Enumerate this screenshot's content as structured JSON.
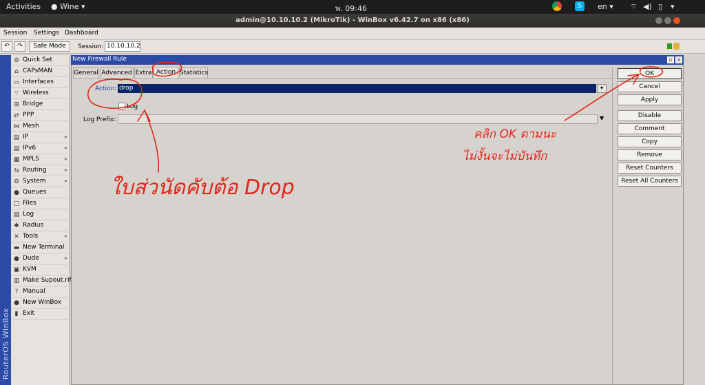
{
  "topbar": {
    "activities": "Activities",
    "app_name": "Wine ▾",
    "clock": "พ. 09:46",
    "lang": "en ▾"
  },
  "window": {
    "title": "admin@10.10.10.2 (MikroTik) - WinBox v6.42.7 on x86 (x86)"
  },
  "menu": [
    "Session",
    "Settings",
    "Dashboard"
  ],
  "toolbar": {
    "safe_mode": "Safe Mode",
    "session_label": "Session:",
    "session_value": "10.10.10.2"
  },
  "brand": "RouterOS WinBox",
  "sidebar": {
    "items": [
      {
        "label": "Quick Set",
        "icon": "quickset-icon",
        "sub": false
      },
      {
        "label": "CAPsMAN",
        "icon": "capsman-icon",
        "sub": false
      },
      {
        "label": "Interfaces",
        "icon": "interfaces-icon",
        "sub": false
      },
      {
        "label": "Wireless",
        "icon": "wireless-icon",
        "sub": false
      },
      {
        "label": "Bridge",
        "icon": "bridge-icon",
        "sub": false
      },
      {
        "label": "PPP",
        "icon": "ppp-icon",
        "sub": false
      },
      {
        "label": "Mesh",
        "icon": "mesh-icon",
        "sub": false
      },
      {
        "label": "IP",
        "icon": "ip-icon",
        "sub": true
      },
      {
        "label": "IPv6",
        "icon": "ipv6-icon",
        "sub": true
      },
      {
        "label": "MPLS",
        "icon": "mpls-icon",
        "sub": true
      },
      {
        "label": "Routing",
        "icon": "routing-icon",
        "sub": true
      },
      {
        "label": "System",
        "icon": "system-icon",
        "sub": true
      },
      {
        "label": "Queues",
        "icon": "queues-icon",
        "sub": false
      },
      {
        "label": "Files",
        "icon": "files-icon",
        "sub": false
      },
      {
        "label": "Log",
        "icon": "log-icon",
        "sub": false
      },
      {
        "label": "Radius",
        "icon": "radius-icon",
        "sub": false
      },
      {
        "label": "Tools",
        "icon": "tools-icon",
        "sub": true
      },
      {
        "label": "New Terminal",
        "icon": "terminal-icon",
        "sub": false
      },
      {
        "label": "Dude",
        "icon": "dude-icon",
        "sub": true
      },
      {
        "label": "KVM",
        "icon": "kvm-icon",
        "sub": false
      },
      {
        "label": "Make Supout.rif",
        "icon": "supout-icon",
        "sub": false
      },
      {
        "label": "Manual",
        "icon": "manual-icon",
        "sub": false
      },
      {
        "label": "New WinBox",
        "icon": "winbox-icon",
        "sub": false
      },
      {
        "label": "Exit",
        "icon": "exit-icon",
        "sub": false
      }
    ]
  },
  "dialog": {
    "title": "New Firewall Rule",
    "tabs": [
      "General",
      "Advanced",
      "Extra",
      "Action",
      "Statistics"
    ],
    "active_tab": "Action",
    "action_label": "Action:",
    "action_value": "drop",
    "log_label": "Log",
    "log_checked": false,
    "log_prefix_label": "Log Prefix:",
    "log_prefix_value": "",
    "buttons": [
      "OK",
      "Cancel",
      "Apply",
      "Disable",
      "Comment",
      "Copy",
      "Remove",
      "Reset Counters",
      "Reset All Counters"
    ]
  },
  "annotations": {
    "ink_color": "#e0261a",
    "note_action": "ใบส่วนัดคับต้อ Drop",
    "note_ok_line1": "คลิก OK ตามนะ",
    "note_ok_line2": "ไม่งั้นจะไม่บันทึก"
  }
}
